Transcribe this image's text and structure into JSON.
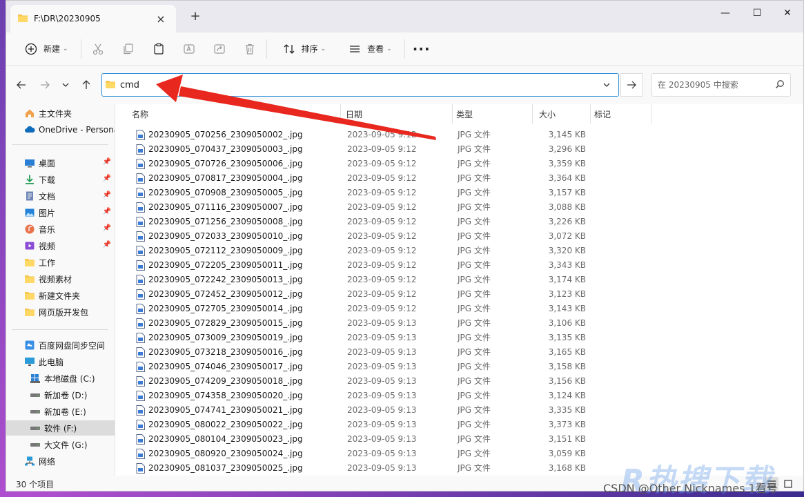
{
  "tab": {
    "title": "F:\\DR\\20230905"
  },
  "toolbar": {
    "new_label": "新建",
    "sort_label": "排序",
    "view_label": "查看"
  },
  "address": {
    "path": "cmd"
  },
  "search": {
    "placeholder": "在 20230905 中搜索"
  },
  "sidebar": {
    "items": [
      {
        "label": "主文件夹",
        "icon": "home-icon"
      },
      {
        "label": "OneDrive - Personal",
        "icon": "cloud-icon"
      },
      {
        "label": "桌面",
        "icon": "desktop-icon",
        "pinned": true
      },
      {
        "label": "下载",
        "icon": "download-icon",
        "pinned": true
      },
      {
        "label": "文档",
        "icon": "document-icon",
        "pinned": true
      },
      {
        "label": "图片",
        "icon": "picture-icon",
        "pinned": true
      },
      {
        "label": "音乐",
        "icon": "music-icon",
        "pinned": true
      },
      {
        "label": "视频",
        "icon": "video-icon",
        "pinned": true
      },
      {
        "label": "工作",
        "icon": "folder-icon"
      },
      {
        "label": "视频素材",
        "icon": "folder-icon"
      },
      {
        "label": "新建文件夹",
        "icon": "folder-icon"
      },
      {
        "label": "网页版开发包",
        "icon": "folder-icon"
      },
      {
        "label": "百度网盘同步空间",
        "icon": "sync-icon"
      },
      {
        "label": "此电脑",
        "icon": "pc-icon"
      },
      {
        "label": "本地磁盘 (C:)",
        "icon": "drive-c-icon"
      },
      {
        "label": "新加卷 (D:)",
        "icon": "drive-icon"
      },
      {
        "label": "新加卷 (E:)",
        "icon": "drive-icon"
      },
      {
        "label": "软件 (F:)",
        "icon": "drive-icon",
        "selected": true
      },
      {
        "label": "大文件 (G:)",
        "icon": "drive-icon"
      },
      {
        "label": "网络",
        "icon": "network-icon"
      }
    ]
  },
  "columns": {
    "name": "名称",
    "date": "日期",
    "type": "类型",
    "size": "大小",
    "tag": "标记"
  },
  "files": [
    {
      "name": "20230905_070256_2309050002_.jpg",
      "date": "2023-09-05 9:12",
      "type": "JPG 文件",
      "size": "3,145 KB"
    },
    {
      "name": "20230905_070437_2309050003_.jpg",
      "date": "2023-09-05 9:12",
      "type": "JPG 文件",
      "size": "3,296 KB"
    },
    {
      "name": "20230905_070726_2309050006_.jpg",
      "date": "2023-09-05 9:12",
      "type": "JPG 文件",
      "size": "3,359 KB"
    },
    {
      "name": "20230905_070817_2309050004_.jpg",
      "date": "2023-09-05 9:12",
      "type": "JPG 文件",
      "size": "3,364 KB"
    },
    {
      "name": "20230905_070908_2309050005_.jpg",
      "date": "2023-09-05 9:12",
      "type": "JPG 文件",
      "size": "3,157 KB"
    },
    {
      "name": "20230905_071116_2309050007_.jpg",
      "date": "2023-09-05 9:12",
      "type": "JPG 文件",
      "size": "3,088 KB"
    },
    {
      "name": "20230905_071256_2309050008_.jpg",
      "date": "2023-09-05 9:12",
      "type": "JPG 文件",
      "size": "3,226 KB"
    },
    {
      "name": "20230905_072033_2309050010_.jpg",
      "date": "2023-09-05 9:12",
      "type": "JPG 文件",
      "size": "3,072 KB"
    },
    {
      "name": "20230905_072112_2309050009_.jpg",
      "date": "2023-09-05 9:12",
      "type": "JPG 文件",
      "size": "3,320 KB"
    },
    {
      "name": "20230905_072205_2309050011_.jpg",
      "date": "2023-09-05 9:12",
      "type": "JPG 文件",
      "size": "3,343 KB"
    },
    {
      "name": "20230905_072242_2309050013_.jpg",
      "date": "2023-09-05 9:12",
      "type": "JPG 文件",
      "size": "3,174 KB"
    },
    {
      "name": "20230905_072452_2309050012_.jpg",
      "date": "2023-09-05 9:12",
      "type": "JPG 文件",
      "size": "3,123 KB"
    },
    {
      "name": "20230905_072705_2309050014_.jpg",
      "date": "2023-09-05 9:12",
      "type": "JPG 文件",
      "size": "3,143 KB"
    },
    {
      "name": "20230905_072829_2309050015_.jpg",
      "date": "2023-09-05 9:13",
      "type": "JPG 文件",
      "size": "3,106 KB"
    },
    {
      "name": "20230905_073009_2309050019_.jpg",
      "date": "2023-09-05 9:13",
      "type": "JPG 文件",
      "size": "3,135 KB"
    },
    {
      "name": "20230905_073218_2309050016_.jpg",
      "date": "2023-09-05 9:13",
      "type": "JPG 文件",
      "size": "3,165 KB"
    },
    {
      "name": "20230905_074046_2309050017_.jpg",
      "date": "2023-09-05 9:13",
      "type": "JPG 文件",
      "size": "3,158 KB"
    },
    {
      "name": "20230905_074209_2309050018_.jpg",
      "date": "2023-09-05 9:13",
      "type": "JPG 文件",
      "size": "3,156 KB"
    },
    {
      "name": "20230905_074358_2309050020_.jpg",
      "date": "2023-09-05 9:13",
      "type": "JPG 文件",
      "size": "3,124 KB"
    },
    {
      "name": "20230905_074741_2309050021_.jpg",
      "date": "2023-09-05 9:13",
      "type": "JPG 文件",
      "size": "3,335 KB"
    },
    {
      "name": "20230905_080022_2309050022_.jpg",
      "date": "2023-09-05 9:13",
      "type": "JPG 文件",
      "size": "3,373 KB"
    },
    {
      "name": "20230905_080104_2309050023_.jpg",
      "date": "2023-09-05 9:13",
      "type": "JPG 文件",
      "size": "3,151 KB"
    },
    {
      "name": "20230905_080920_2309050024_.jpg",
      "date": "2023-09-05 9:13",
      "type": "JPG 文件",
      "size": "3,059 KB"
    },
    {
      "name": "20230905_081037_2309050025_.jpg",
      "date": "2023-09-05 9:13",
      "type": "JPG 文件",
      "size": "3,168 KB"
    }
  ],
  "status": {
    "count": "30 个项目"
  },
  "watermark": {
    "logo": "R热搜下载",
    "text": "CSDN @Other Nicknames 1看号"
  },
  "colors": {
    "accent": "#2f8fd8",
    "folder": "#f4c54a",
    "arrow": "#e8281e"
  }
}
